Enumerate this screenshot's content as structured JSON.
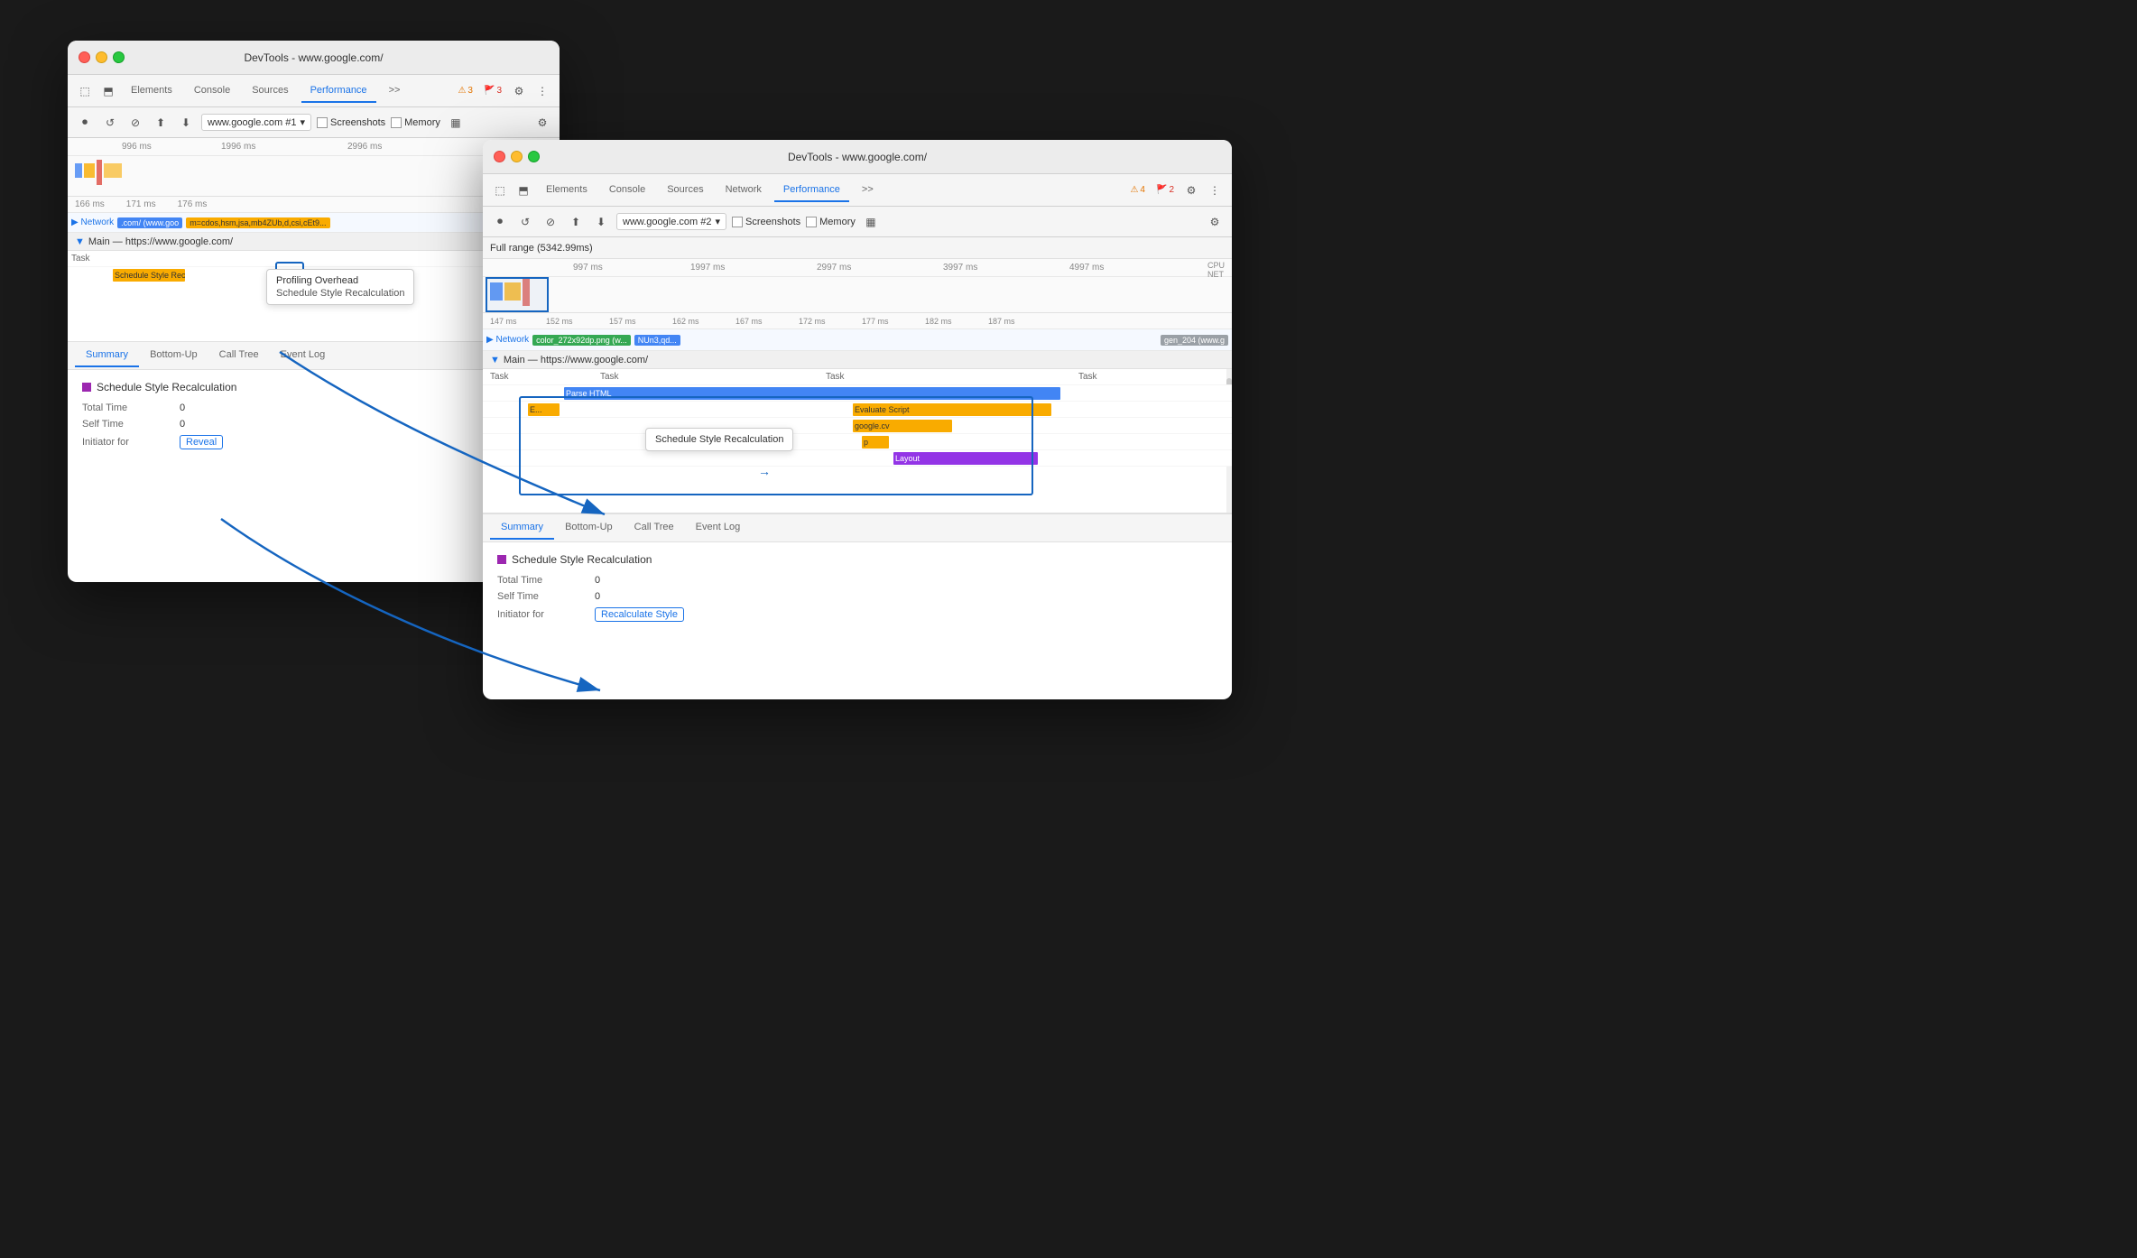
{
  "window1": {
    "title": "DevTools - www.google.com/",
    "tabs": [
      "Elements",
      "Console",
      "Sources",
      "Performance",
      ">>"
    ],
    "active_tab": "Performance",
    "warnings": {
      "orange": "3",
      "red": "3"
    },
    "toolbar2": {
      "url": "www.google.com #1",
      "screenshots_label": "Screenshots",
      "memory_label": "Memory"
    },
    "full_range": "996 ms",
    "ruler_marks": [
      "166 ms",
      "171 ms",
      "176 ms"
    ],
    "network_label": "Network",
    "network_items": [
      ".com/ (www.goo",
      "m=cdos,hsm,jsa,mb4ZUb,d,csi,cEt9..."
    ],
    "main_label": "Main — https://www.google.com/",
    "task_label": "Task",
    "tooltip": {
      "profiling": "Profiling Overhead",
      "schedule": "Schedule Style Recalculation"
    },
    "bottom_tabs": [
      "Summary",
      "Bottom-Up",
      "Call Tree",
      "Event Log"
    ],
    "active_bottom_tab": "Summary",
    "summary": {
      "title": "Schedule Style Recalculation",
      "total_time_label": "Total Time",
      "total_time_value": "0",
      "self_time_label": "Self Time",
      "self_time_value": "0",
      "initiator_label": "Initiator for",
      "initiator_link": "Reveal"
    }
  },
  "window2": {
    "title": "DevTools - www.google.com/",
    "tabs": [
      "Elements",
      "Console",
      "Sources",
      "Network",
      "Performance",
      ">>"
    ],
    "active_tab": "Performance",
    "warnings": {
      "orange": "4",
      "red": "2"
    },
    "toolbar2": {
      "url": "www.google.com #2",
      "screenshots_label": "Screenshots",
      "memory_label": "Memory"
    },
    "full_range": "Full range (5342.99ms)",
    "ruler_marks": [
      "997 ms",
      "1997 ms",
      "2997 ms",
      "3997 ms",
      "4997 ms"
    ],
    "time_marks": [
      "147 ms",
      "152 ms",
      "157 ms",
      "162 ms",
      "167 ms",
      "172 ms",
      "177 ms",
      "182 ms",
      "187 ms"
    ],
    "network_label": "Network",
    "network_items": [
      "color_272x92dp.png (w...",
      "NUn3,qd...",
      "gen_204 (www.g"
    ],
    "main_label": "Main — https://www.google.com/",
    "task_labels": [
      "Task",
      "Task",
      "Task",
      "Task"
    ],
    "flame_blocks": [
      {
        "label": "E...",
        "color": "yellow"
      },
      {
        "label": "Parse HTML",
        "color": "blue"
      },
      {
        "label": "Evaluate Script",
        "color": "yellow"
      },
      {
        "label": "google.cv",
        "color": "yellow"
      },
      {
        "label": "p",
        "color": "yellow"
      },
      {
        "label": "Layout",
        "color": "purple"
      }
    ],
    "callout": "Schedule Style Recalculation",
    "bottom_tabs": [
      "Summary",
      "Bottom-Up",
      "Call Tree",
      "Event Log"
    ],
    "active_bottom_tab": "Summary",
    "summary": {
      "title": "Schedule Style Recalculation",
      "total_time_label": "Total Time",
      "total_time_value": "0",
      "self_time_label": "Self Time",
      "self_time_value": "0",
      "initiator_label": "Initiator for",
      "initiator_link": "Recalculate Style"
    }
  },
  "icons": {
    "record": "⏺",
    "reload": "↺",
    "clear": "⊘",
    "upload": "⬆",
    "download": "⬇",
    "settings": "⚙",
    "more": "⋮",
    "chevron_down": "▾",
    "screenshot_icon": "📷",
    "timeline_icon": "▦",
    "dock_icon": "⬒",
    "inspect": "⬚",
    "cursor": "↖"
  }
}
